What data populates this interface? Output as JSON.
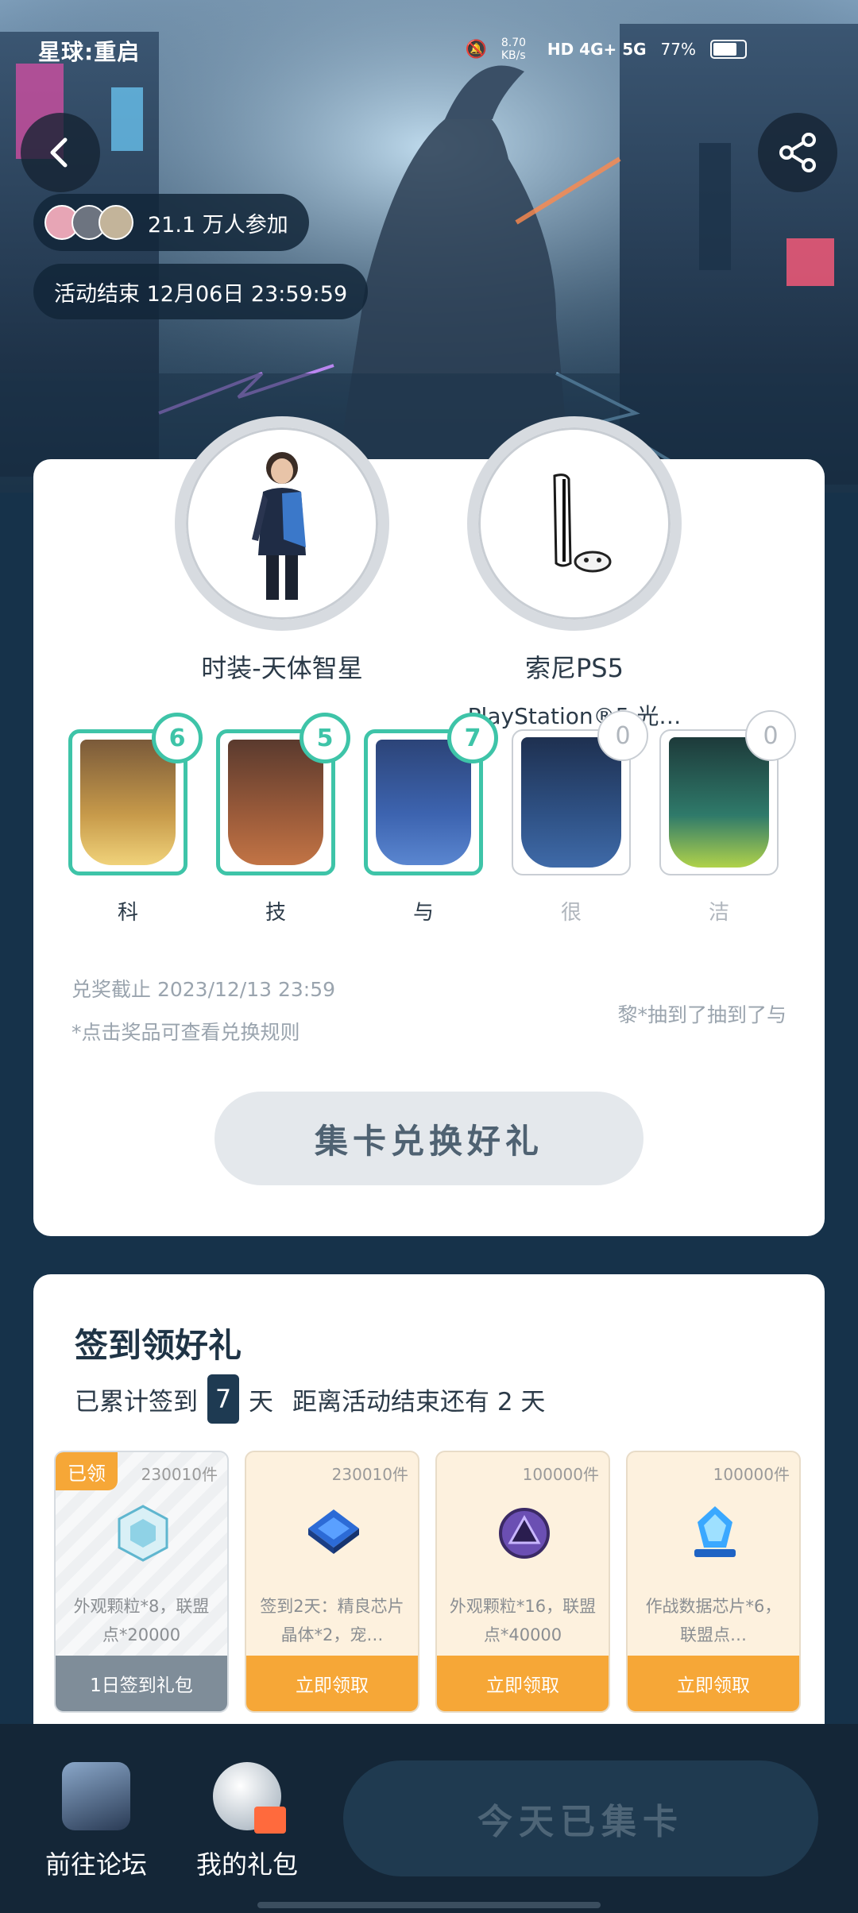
{
  "status_bar": {
    "brand": "星球:重启",
    "net_speed": "8.70 KB/s",
    "network": "HD 4G+ 5G",
    "battery": "77%"
  },
  "header": {
    "back_icon": "chevron-left-icon",
    "share_icon": "share-icon",
    "participants": "21.1 万人参加",
    "end_time": "活动结束 12月06日 23:59:59"
  },
  "prizes": [
    {
      "name": "时装-天体智星",
      "subtitle": ""
    },
    {
      "name": "索尼PS5",
      "subtitle": "PlayStation®5 光…"
    }
  ],
  "collect_cards": [
    {
      "label": "科",
      "count": "6",
      "owned": true
    },
    {
      "label": "技",
      "count": "5",
      "owned": true
    },
    {
      "label": "与",
      "count": "7",
      "owned": true
    },
    {
      "label": "很",
      "count": "0",
      "owned": false
    },
    {
      "label": "洁",
      "count": "0",
      "owned": false
    }
  ],
  "exchange": {
    "deadline": "兑奖截止 2023/12/13 23:59",
    "rule_hint": "*点击奖品可查看兑换规则",
    "ticker": "黎*抽到了抽到了与",
    "button": "集卡兑换好礼"
  },
  "signin": {
    "title": "签到领好礼",
    "prefix": "已累计签到",
    "days": "7",
    "days_unit": "天",
    "remaining": "距离活动结束还有 2 天",
    "gifts": [
      {
        "tag": "已领",
        "stock": "230010件",
        "desc": "外观颗粒*8，联盟点*20000",
        "action": "1日签到礼包",
        "state": "claimed"
      },
      {
        "tag": "",
        "stock": "230010件",
        "desc": "签到2天：精良芯片晶体*2，宠…",
        "action": "立即领取",
        "state": "open"
      },
      {
        "tag": "",
        "stock": "100000件",
        "desc": "外观颗粒*16，联盟点*40000",
        "action": "立即领取",
        "state": "open"
      },
      {
        "tag": "",
        "stock": "100000件",
        "desc": "作战数据芯片*6，联盟点…",
        "action": "立即领取",
        "state": "open"
      }
    ]
  },
  "bottom_nav": {
    "forum": "前往论坛",
    "gifts": "我的礼包",
    "collect_button": "今天已集卡"
  },
  "colors": {
    "accent_teal": "#3ec4a8",
    "orange": "#f6a737",
    "dark_navy": "#142637"
  }
}
